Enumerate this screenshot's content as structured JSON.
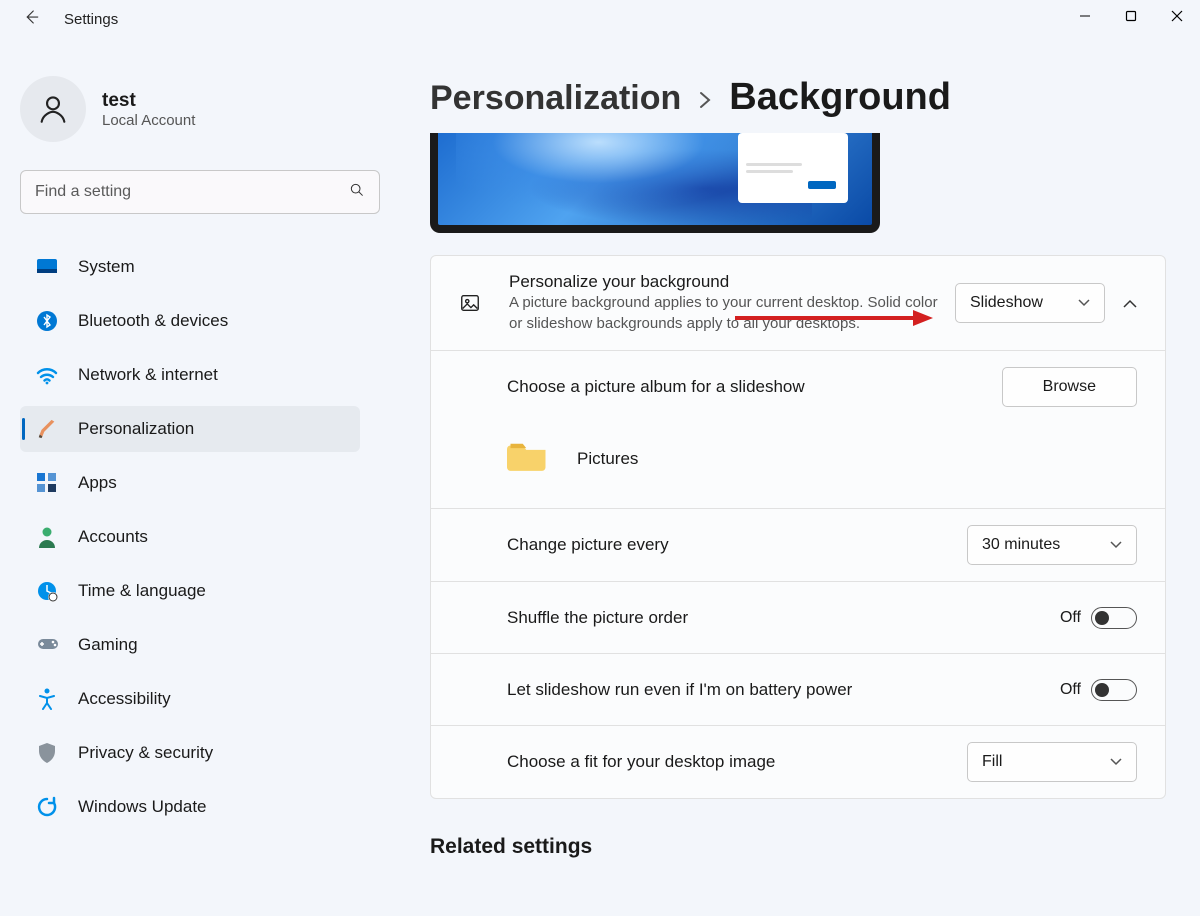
{
  "titlebar": {
    "app_title": "Settings"
  },
  "profile": {
    "name": "test",
    "sub": "Local Account"
  },
  "search": {
    "placeholder": "Find a setting"
  },
  "nav": {
    "items": [
      {
        "label": "System"
      },
      {
        "label": "Bluetooth & devices"
      },
      {
        "label": "Network & internet"
      },
      {
        "label": "Personalization"
      },
      {
        "label": "Apps"
      },
      {
        "label": "Accounts"
      },
      {
        "label": "Time & language"
      },
      {
        "label": "Gaming"
      },
      {
        "label": "Accessibility"
      },
      {
        "label": "Privacy & security"
      },
      {
        "label": "Windows Update"
      }
    ]
  },
  "breadcrumb": {
    "parent": "Personalization",
    "current": "Background"
  },
  "rows": {
    "personalize_title": "Personalize your background",
    "personalize_sub": "A picture background applies to your current desktop. Solid color or slideshow backgrounds apply to all your desktops.",
    "personalize_value": "Slideshow",
    "album_title": "Choose a picture album for a slideshow",
    "browse_label": "Browse",
    "folder_name": "Pictures",
    "change_title": "Change picture every",
    "change_value": "30 minutes",
    "shuffle_title": "Shuffle the picture order",
    "shuffle_value": "Off",
    "battery_title": "Let slideshow run even if I'm on battery power",
    "battery_value": "Off",
    "fit_title": "Choose a fit for your desktop image",
    "fit_value": "Fill"
  },
  "related_title": "Related settings"
}
